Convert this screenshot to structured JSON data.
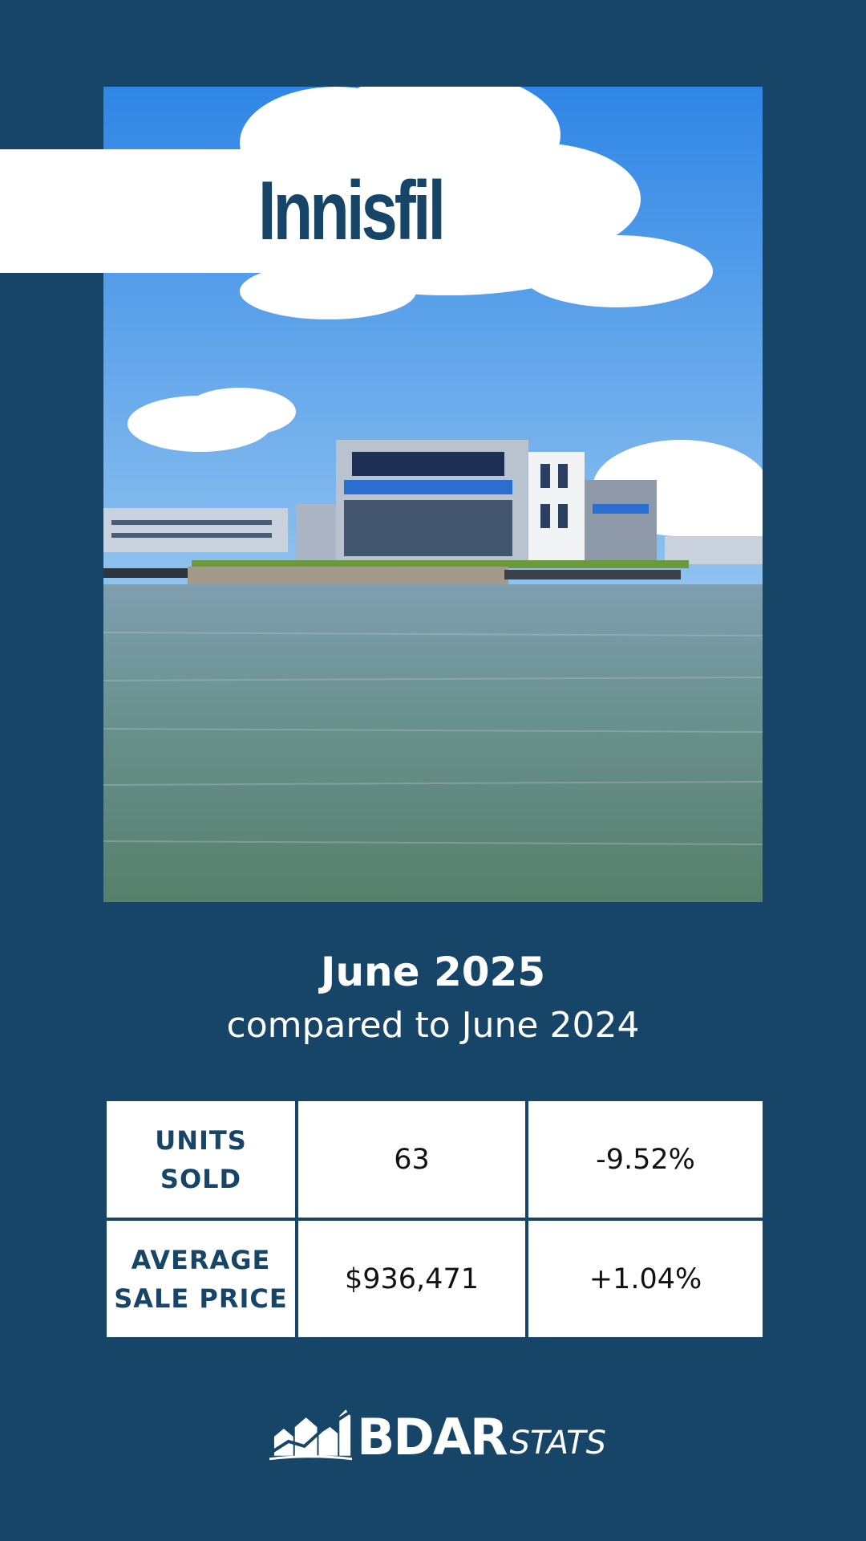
{
  "title": "Innisfil",
  "period": {
    "main": "June 2025",
    "sub": "compared to June 2024"
  },
  "stats": {
    "rows": [
      {
        "label": "UNITS\nSOLD",
        "value": "63",
        "change": "-9.52%"
      },
      {
        "label": "AVERAGE\nSALE PRICE",
        "value": "$936,471",
        "change": "+1.04%"
      }
    ]
  },
  "logo": {
    "brand": "BDAR",
    "suffix": "STATS"
  },
  "colors": {
    "background": "#164568",
    "accent": "#164568",
    "cell": "#ffffff"
  },
  "photo": {
    "subject": "waterfront-building-photo"
  }
}
